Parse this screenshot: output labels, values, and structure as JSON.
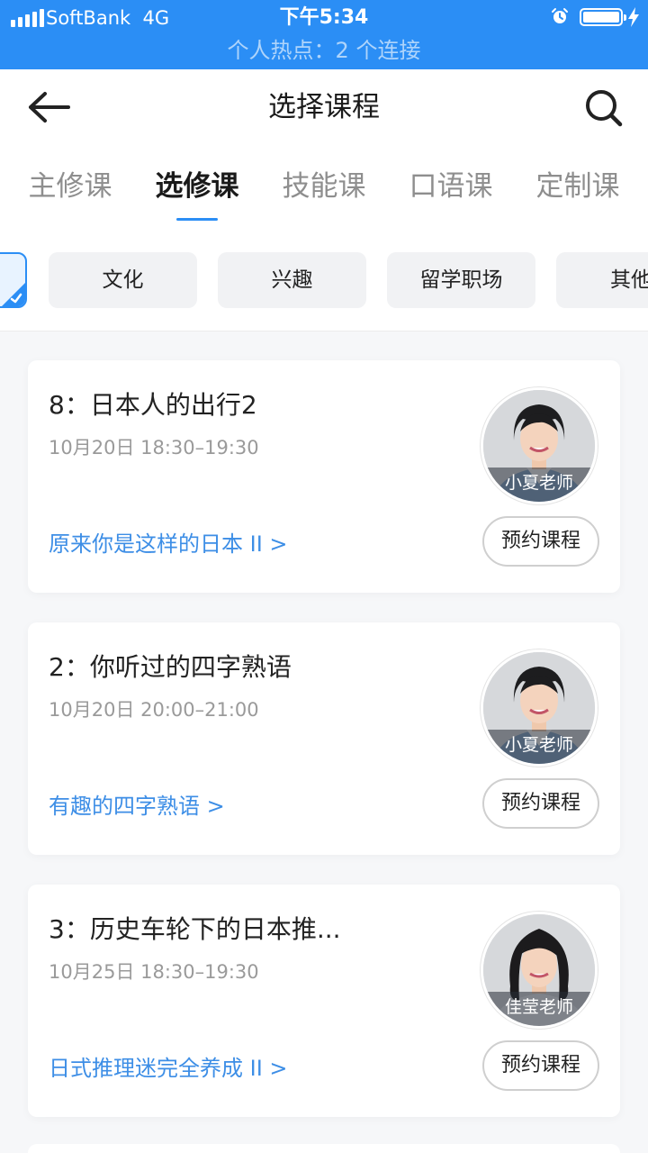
{
  "status_bar": {
    "carrier": "SoftBank",
    "network": "4G",
    "time": "下午5:34",
    "hotspot": "个人热点：2 个连接",
    "icons": [
      "signal-icon",
      "alarm-icon",
      "battery-icon",
      "charging-icon"
    ]
  },
  "header": {
    "title": "选择课程",
    "icons": [
      "back-arrow-icon",
      "search-icon"
    ]
  },
  "tabs": [
    {
      "label": "主修课",
      "active": false
    },
    {
      "label": "选修课",
      "active": true
    },
    {
      "label": "技能课",
      "active": false
    },
    {
      "label": "口语课",
      "active": false
    },
    {
      "label": "定制课",
      "active": false
    }
  ],
  "filters": [
    {
      "label": "文化"
    },
    {
      "label": "兴趣"
    },
    {
      "label": "留学职场"
    },
    {
      "label": "其他"
    }
  ],
  "courses": [
    {
      "title": "8：日本人的出行2",
      "time": "10月20日  18:30–19:30",
      "series": "原来你是这样的日本 II  >",
      "teacher": "小夏老师",
      "book_label": "预约课程"
    },
    {
      "title": "2：你听过的四字熟语",
      "time": "10月20日  20:00–21:00",
      "series": "有趣的四字熟语  >",
      "teacher": "小夏老师",
      "book_label": "预约课程"
    },
    {
      "title": "3：历史车轮下的日本推...",
      "time": "10月25日  18:30–19:30",
      "series": "日式推理迷完全养成 II  >",
      "teacher": "佳莹老师",
      "book_label": "预约课程"
    }
  ],
  "colors": {
    "accent": "#2b8ef5",
    "link": "#3d8ee6",
    "background": "#f6f7f9"
  }
}
